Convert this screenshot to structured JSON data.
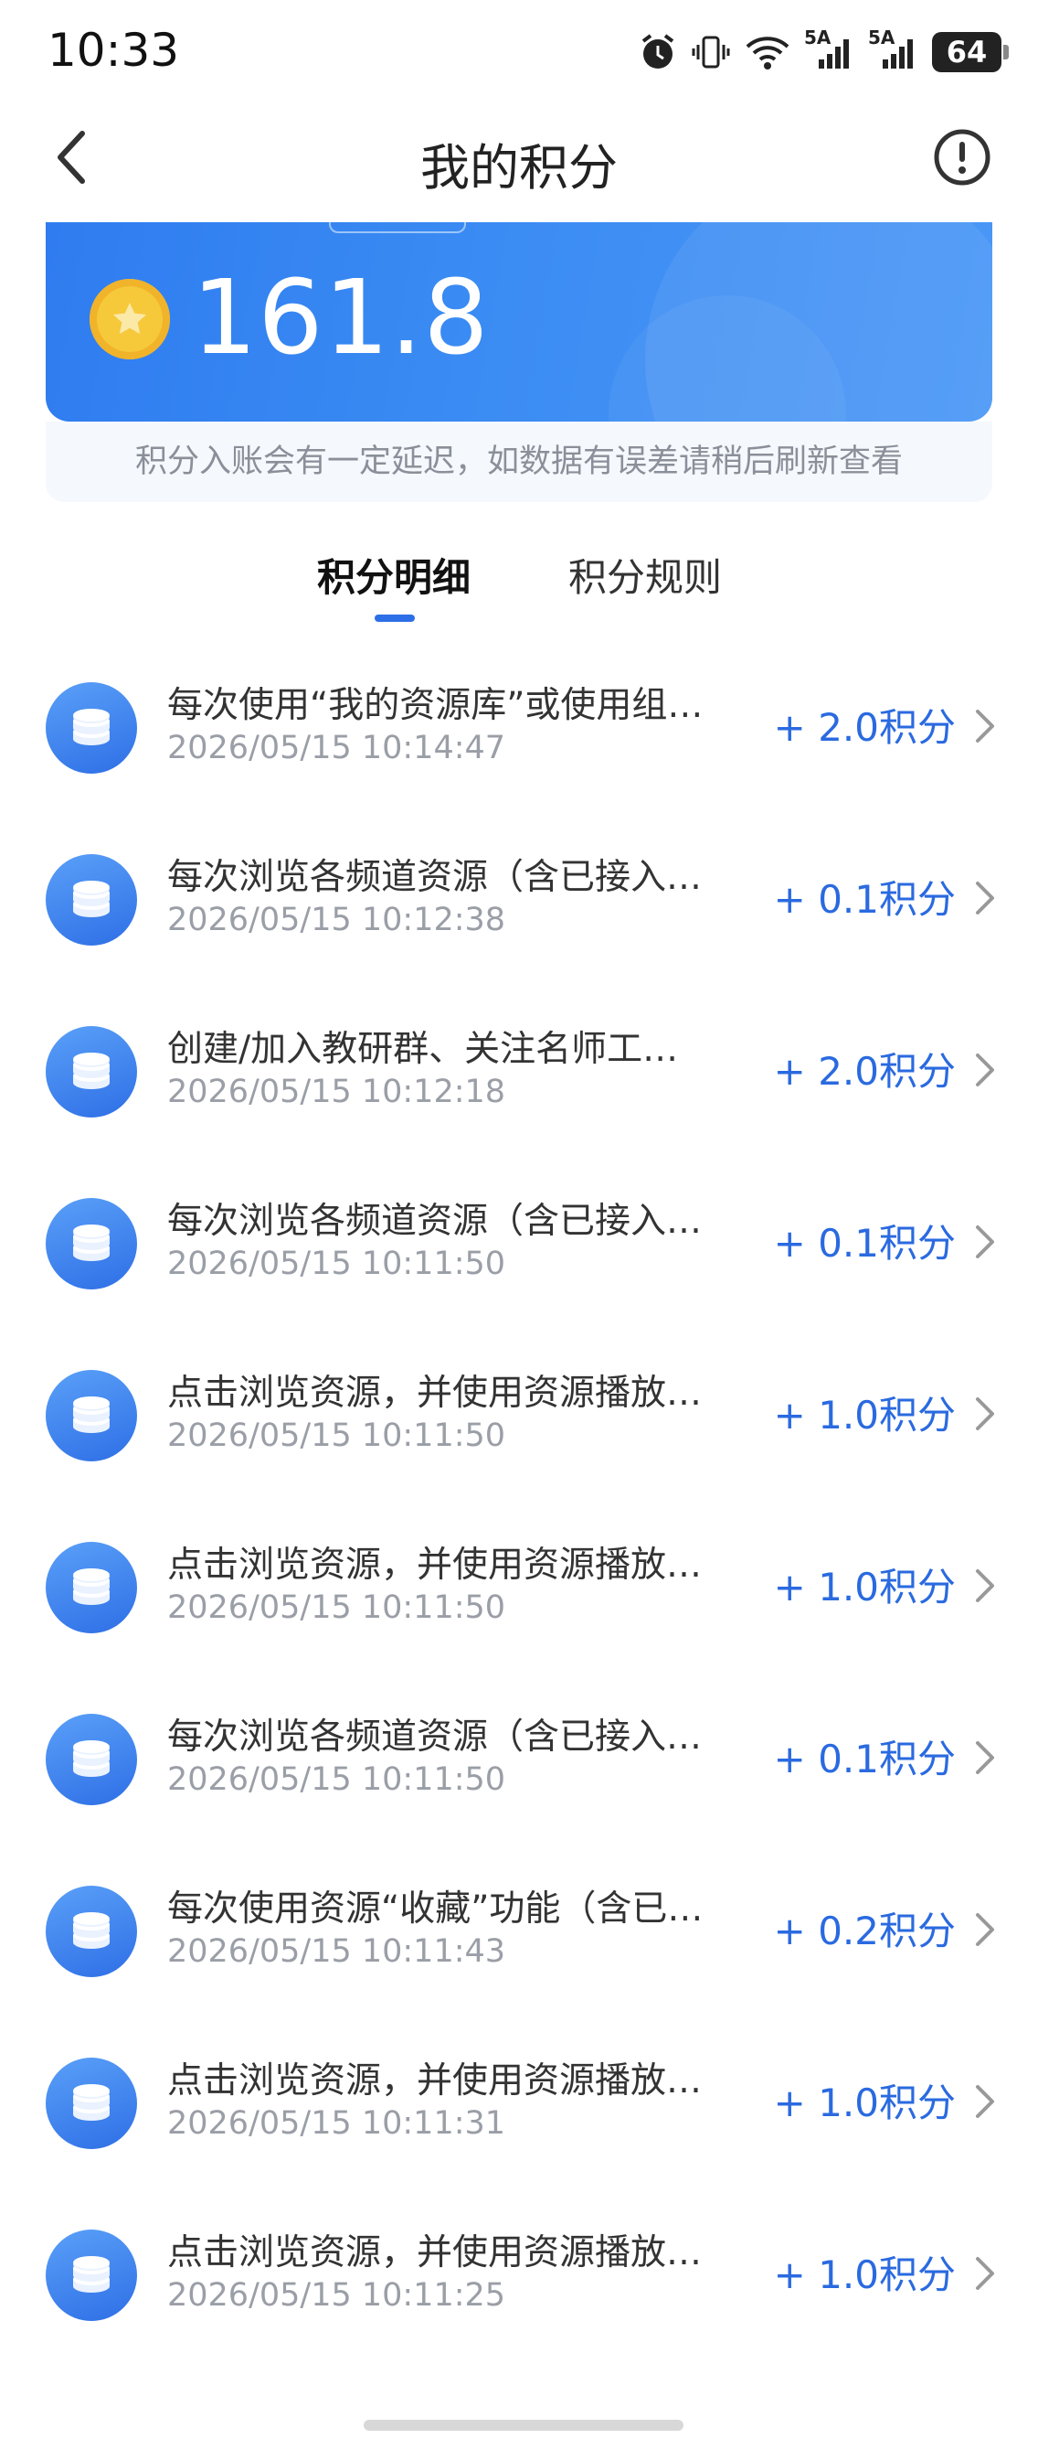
{
  "status_bar": {
    "time": "10:33",
    "signal1": "5A",
    "signal2": "5A",
    "battery": "64"
  },
  "header": {
    "title": "我的积分"
  },
  "balance": {
    "value": "161.8",
    "notice": "积分入账会有一定延迟，如数据有误差请稍后刷新查看"
  },
  "tabs": [
    {
      "label": "积分明细"
    },
    {
      "label": "积分规则"
    }
  ],
  "records": [
    {
      "title": "每次使用“我的资源库”或使用组…",
      "time": "2026/05/15 10:14:47",
      "points": "+ 2.0积分"
    },
    {
      "title": "每次浏览各频道资源（含已接入…",
      "time": "2026/05/15 10:12:38",
      "points": "+ 0.1积分"
    },
    {
      "title": "创建/加入教研群、关注名师工…",
      "time": "2026/05/15 10:12:18",
      "points": "+ 2.0积分"
    },
    {
      "title": "每次浏览各频道资源（含已接入…",
      "time": "2026/05/15 10:11:50",
      "points": "+ 0.1积分"
    },
    {
      "title": "点击浏览资源，并使用资源播放…",
      "time": "2026/05/15 10:11:50",
      "points": "+ 1.0积分"
    },
    {
      "title": "点击浏览资源，并使用资源播放…",
      "time": "2026/05/15 10:11:50",
      "points": "+ 1.0积分"
    },
    {
      "title": "每次浏览各频道资源（含已接入…",
      "time": "2026/05/15 10:11:50",
      "points": "+ 0.1积分"
    },
    {
      "title": "每次使用资源“收藏”功能（含已…",
      "time": "2026/05/15 10:11:43",
      "points": "+ 0.2积分"
    },
    {
      "title": "点击浏览资源，并使用资源播放…",
      "time": "2026/05/15 10:11:31",
      "points": "+ 1.0积分"
    },
    {
      "title": "点击浏览资源，并使用资源播放…",
      "time": "2026/05/15 10:11:25",
      "points": "+ 1.0积分"
    }
  ],
  "colors": {
    "accent": "#2a6ae0",
    "hero_start": "#2f7cf0",
    "hero_end": "#4a97f6",
    "coin": "#f6c93b"
  },
  "icons": {
    "back": "chevron-left-icon",
    "info": "info-icon",
    "coin": "star-coin-icon",
    "record": "coin-stack-icon",
    "row_arrow": "chevron-right-icon"
  }
}
